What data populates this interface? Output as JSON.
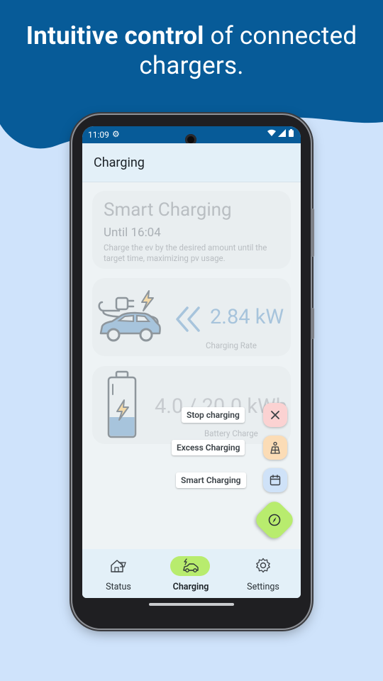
{
  "headline": {
    "bold": "Intuitive control",
    "rest": " of connected chargers."
  },
  "status_bar": {
    "time": "11:09",
    "icons": [
      "settings-icon",
      "wifi-icon",
      "signal-icon",
      "battery-icon"
    ]
  },
  "app_bar": {
    "title": "Charging"
  },
  "smart_card": {
    "title": "Smart Charging",
    "until": "Until 16:04",
    "description": "Charge the ev by the desired amount until the target time, maximizing pv usage."
  },
  "rate_card": {
    "value": "2.84 kW",
    "label": "Charging Rate"
  },
  "battery_card": {
    "value": "4.0 / 20.0 kWh",
    "label": "Battery Charge"
  },
  "fab_menu": {
    "stop_label": "Stop charging",
    "excess_label": "Excess Charging",
    "smart_label": "Smart Charging",
    "colors": {
      "stop": "#fbd2d2",
      "excess": "#fbdcb6",
      "smart": "#cfe2f8",
      "main": "#b8ec6e"
    }
  },
  "nav": {
    "items": [
      {
        "label": "Status",
        "icon": "house-solar-icon"
      },
      {
        "label": "Charging",
        "icon": "car-charging-icon",
        "active": true
      },
      {
        "label": "Settings",
        "icon": "gear-icon"
      }
    ]
  },
  "colors": {
    "brand_blue": "#075b98",
    "page_bg": "#cfe3fb",
    "active_pill": "#b8ec6e"
  }
}
